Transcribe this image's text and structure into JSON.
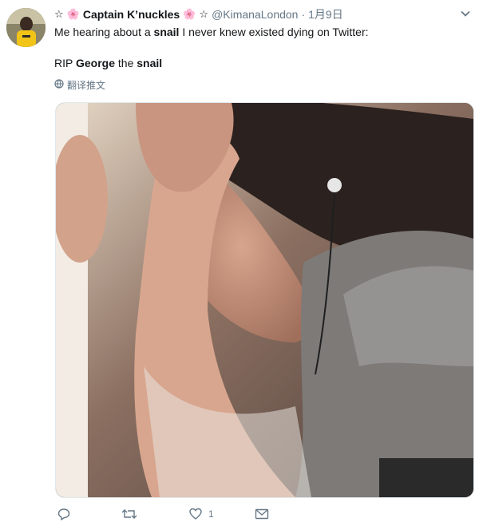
{
  "tweet": {
    "star_before": "☆",
    "flower_left": "🌸",
    "display_name": "Captain K’nuckles",
    "flower_right": "🌸",
    "star_after": "☆",
    "handle": "@KimanaLondon",
    "separator": "·",
    "date": "1月9日",
    "text_line1_a": "Me hearing about a ",
    "text_line1_b": "snail",
    "text_line1_c": " I never knew existed dying on Twitter:",
    "text_line2_a": "RIP ",
    "text_line2_b": "George",
    "text_line2_c": " the ",
    "text_line2_d": "snail",
    "translate_label": "翻译推文",
    "like_count": "1"
  },
  "icons": {
    "caret": "chevron-down-icon",
    "globe": "globe-icon",
    "reply": "reply-icon",
    "retweet": "retweet-icon",
    "like": "heart-icon",
    "message": "envelope-icon"
  },
  "colors": {
    "text": "#14171a",
    "secondary": "#657786",
    "border": "#e1e8ed"
  }
}
